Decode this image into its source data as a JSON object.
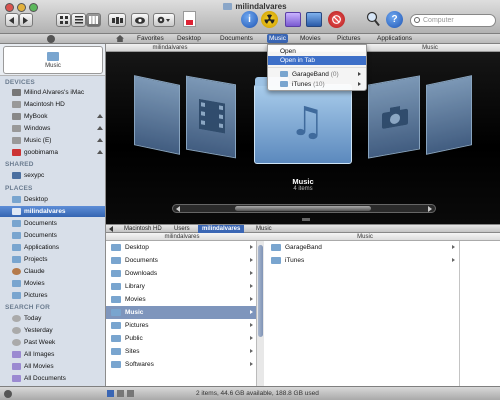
{
  "window": {
    "title": "milindalvares"
  },
  "toolbar": {
    "search_placeholder": "Computer"
  },
  "favorites": [
    {
      "label": "Favorites",
      "active": false
    },
    {
      "label": "Desktop",
      "active": false
    },
    {
      "label": "Documents",
      "active": false
    },
    {
      "label": "Music",
      "active": true
    },
    {
      "label": "Movies",
      "active": false
    },
    {
      "label": "Pictures",
      "active": false
    },
    {
      "label": "Applications",
      "active": false
    }
  ],
  "column_header_top": {
    "left": "milindalvares",
    "right": "Music"
  },
  "menu": {
    "items": [
      "Open",
      "Open in Tab"
    ],
    "highlighted": "Open in Tab",
    "subitems": [
      {
        "label": "GarageBand",
        "count": "(0)"
      },
      {
        "label": "iTunes",
        "count": "(10)"
      }
    ]
  },
  "sidebar": {
    "top_item": "Music",
    "devices_header": "DEVICES",
    "devices": [
      "Milind Alvares's iMac",
      "Macintosh HD",
      "MyBook",
      "Windows",
      "Music (E)",
      "goobimama"
    ],
    "shared_header": "SHARED",
    "shared": [
      "sexypc"
    ],
    "places_header": "PLACES",
    "places": [
      "Desktop",
      "milindalvares",
      "Documents",
      "Documents",
      "Applications",
      "Projects",
      "Claude",
      "Movies",
      "Pictures"
    ],
    "selected": "milindalvares",
    "search_header": "SEARCH FOR",
    "search_for": [
      "Today",
      "Yesterday",
      "Past Week",
      "All Images",
      "All Movies",
      "All Documents"
    ]
  },
  "coverflow": {
    "title": "Music",
    "subtitle": "4 items"
  },
  "pathbar": [
    "Macintosh HD",
    "Users",
    "milindalvares",
    "Music"
  ],
  "pathbar_selected": "milindalvares",
  "columns": {
    "col1_header": "milindalvares",
    "col2_header": "Music",
    "col1": [
      "Desktop",
      "Documents",
      "Downloads",
      "Library",
      "Movies",
      "Music",
      "Pictures",
      "Public",
      "Sites",
      "Softwares"
    ],
    "col1_selected": "Music",
    "col2": [
      "GarageBand",
      "iTunes"
    ]
  },
  "status": {
    "text": "2 items, 44.6 GB available, 188.8 GB used"
  },
  "colors": {
    "selection": "#3465b2",
    "accent": "#3a66b4"
  }
}
